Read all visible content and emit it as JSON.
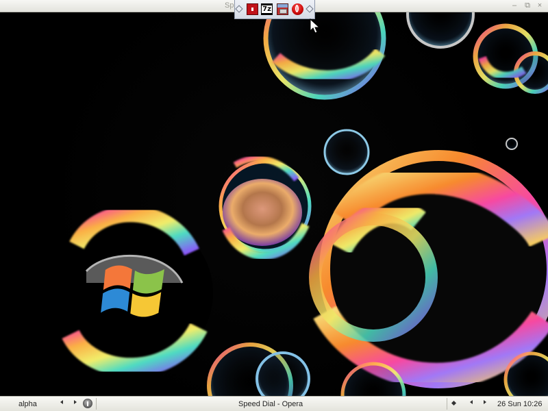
{
  "window": {
    "partial_title": "Sp",
    "controls": {
      "minimize_icon": "minimize-icon",
      "restore_icon": "restore-icon",
      "close_icon": "close-icon"
    }
  },
  "launch_toolbar": {
    "icons": [
      {
        "name": "pdf-icon",
        "label": ""
      },
      {
        "name": "seven-zip-icon",
        "label": "7z"
      },
      {
        "name": "toolbox-icon",
        "label": ""
      },
      {
        "name": "opera-icon",
        "label": ""
      }
    ]
  },
  "desktop": {
    "background": "bubbles",
    "logo": "windows-logo"
  },
  "taskbar": {
    "desktop_name": "alpha",
    "active_window": "Speed Dial - Opera",
    "clock": "26 Sun 10:26",
    "icons": [
      "left-arrow-icon",
      "right-arrow-icon",
      "info-icon",
      "tray-diamond-icon"
    ]
  },
  "colors": {
    "titlebar": "#ecece6",
    "taskbar": "#eeeeea",
    "launch_bar": "#dfe4ee",
    "opera_red": "#d01010"
  }
}
